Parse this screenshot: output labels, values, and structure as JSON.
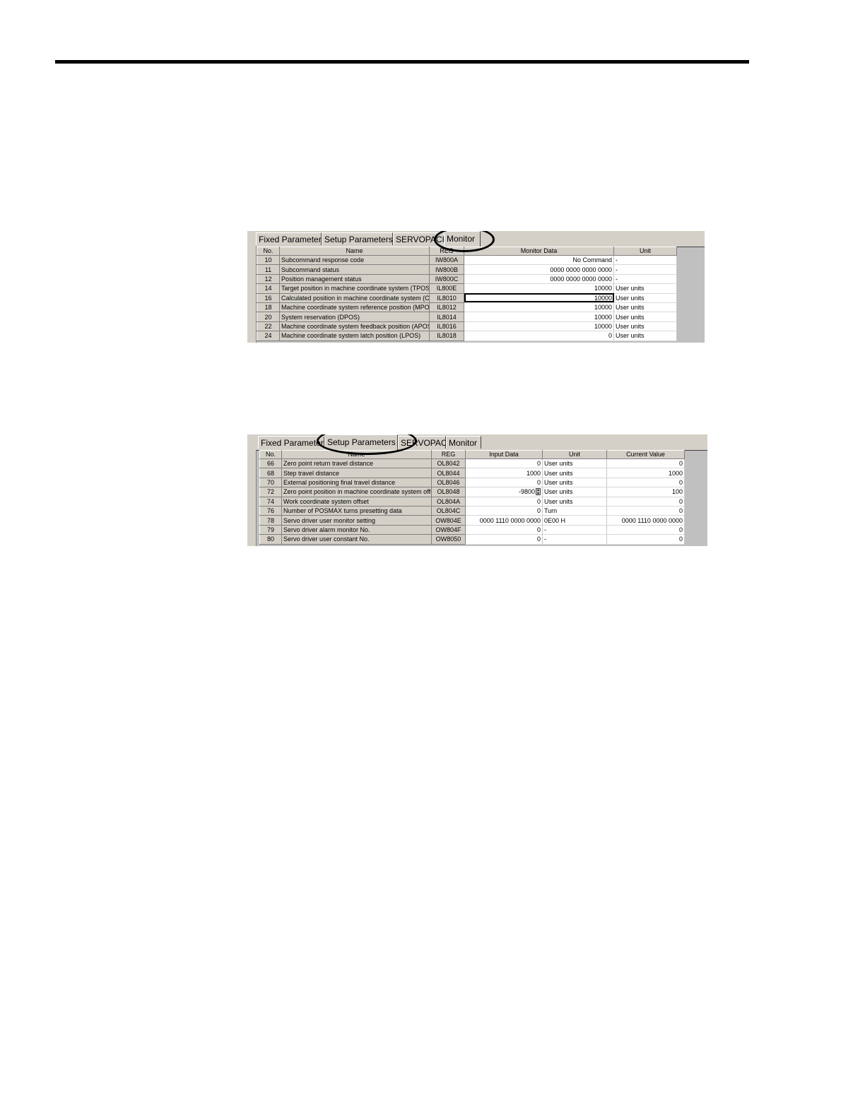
{
  "monitor_panel": {
    "tabs": [
      "Fixed Parameters",
      "Setup Parameters",
      "SERVOPACK",
      "Monitor"
    ],
    "active_tab": "Monitor",
    "columns": [
      "No.",
      "Name",
      "REG",
      "Monitor Data",
      "Unit"
    ],
    "rows": [
      {
        "no": "10",
        "name": "Subcommand response code",
        "reg": "IW800A",
        "data": "No Command",
        "unit": "-"
      },
      {
        "no": "11",
        "name": "Subcommand status",
        "reg": "IW800B",
        "data": "0000 0000 0000 0000",
        "unit": "-"
      },
      {
        "no": "12",
        "name": "Position management status",
        "reg": "IW800C",
        "data": "0000 0000 0000 0000",
        "unit": "-"
      },
      {
        "no": "14",
        "name": "Target position in machine coordinate system (TPOS)",
        "reg": "IL800E",
        "data": "10000",
        "unit": "User units"
      },
      {
        "no": "16",
        "name": "Calculated position in machine coordinate system (CPOS)",
        "reg": "IL8010",
        "data": "10000",
        "unit": "User units"
      },
      {
        "no": "18",
        "name": "Machine coordinate system reference position (MPOS)",
        "reg": "IL8012",
        "data": "10000",
        "unit": "User units"
      },
      {
        "no": "20",
        "name": "System reservation (DPOS)",
        "reg": "IL8014",
        "data": "10000",
        "unit": "User units"
      },
      {
        "no": "22",
        "name": "Machine coordinate system feedback position (APOS)",
        "reg": "IL8016",
        "data": "10000",
        "unit": "User units"
      },
      {
        "no": "24",
        "name": "Machine coordinate system latch position (LPOS)",
        "reg": "IL8018",
        "data": "0",
        "unit": "User units"
      }
    ]
  },
  "setup_panel": {
    "tabs": [
      "Fixed Parameters",
      "Setup Parameters",
      "SERVOPACK",
      "Monitor"
    ],
    "active_tab": "Setup Parameters",
    "columns": [
      "No.",
      "Name",
      "REG",
      "Input Data",
      "Unit",
      "Current Value"
    ],
    "rows": [
      {
        "no": "66",
        "name": "Zero point return travel distance",
        "reg": "OL8042",
        "input": "0",
        "unit": "User units",
        "current": "0"
      },
      {
        "no": "68",
        "name": "Step travel distance",
        "reg": "OL8044",
        "input": "1000",
        "unit": "User units",
        "current": "1000"
      },
      {
        "no": "70",
        "name": "External positioning final travel distance",
        "reg": "OL8046",
        "input": "0",
        "unit": "User units",
        "current": "0"
      },
      {
        "no": "72",
        "name": "Zero point position in machine coordinate system offset",
        "reg": "OL8048",
        "input": "-9800",
        "unit": "User units",
        "current": "100"
      },
      {
        "no": "74",
        "name": "Work coordinate system offset",
        "reg": "OL804A",
        "input": "0",
        "unit": "User units",
        "current": "0"
      },
      {
        "no": "76",
        "name": "Number of POSMAX turns presetting data",
        "reg": "OL804C",
        "input": "0",
        "unit": "Turn",
        "current": "0"
      },
      {
        "no": "78",
        "name": "Servo driver user monitor setting",
        "reg": "OW804E",
        "input": "0000 1110 0000 0000",
        "unit": "0E00 H",
        "current": "0000 1110 0000 0000"
      },
      {
        "no": "79",
        "name": "Servo driver alarm monitor No.",
        "reg": "OW804F",
        "input": "0",
        "unit": "-",
        "current": "0"
      },
      {
        "no": "80",
        "name": "Servo driver user constant No.",
        "reg": "OW8050",
        "input": "0",
        "unit": "-",
        "current": "0"
      }
    ]
  }
}
